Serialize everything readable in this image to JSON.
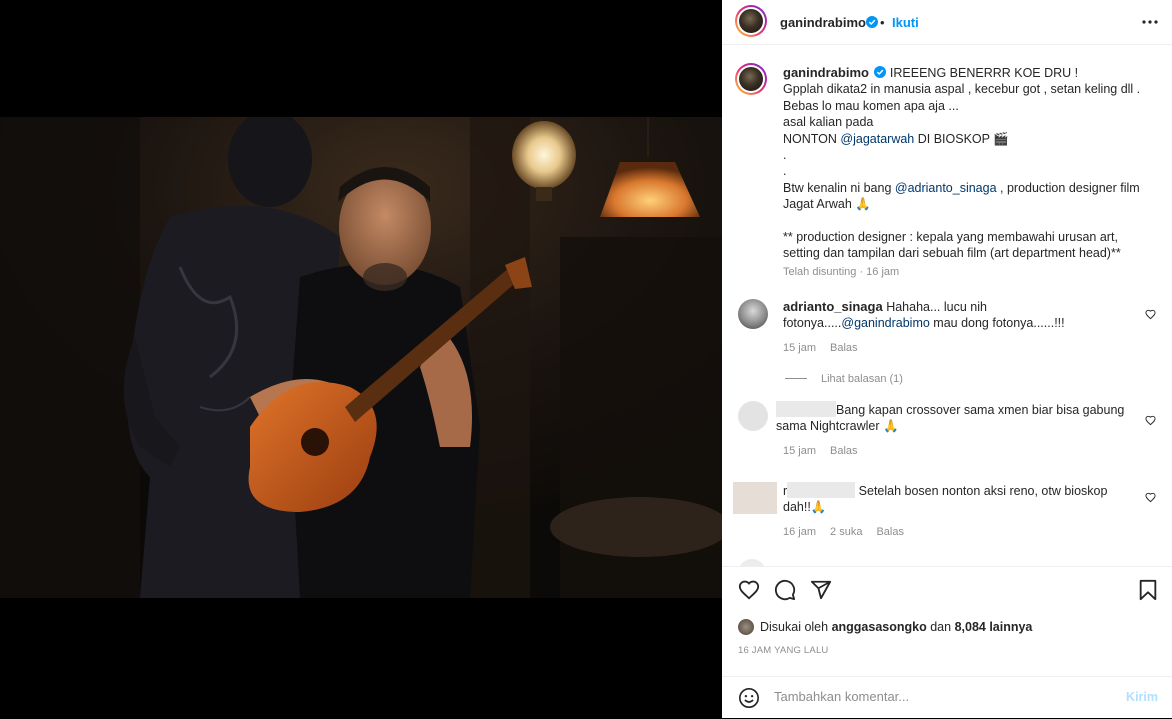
{
  "post": {
    "author": "ganindrabimo",
    "follow_label": "Ikuti",
    "more_icon": "more-horizontal-icon",
    "caption": {
      "title": "IREEENG BENERRR KOE DRU !",
      "line2": "Gpplah dikata2 in manusia aspal , kecebur got , setan keling dll .",
      "line3": "Bebas lo mau komen apa aja ...",
      "line4": "asal kalian pada",
      "line5_prefix": "NONTON ",
      "line5_mention": "@jagatarwah",
      "line5_suffix": " DI BIOSKOP 🎬",
      "dot1": ".",
      "dot2": ".",
      "line8_prefix": "Btw kenalin ni bang ",
      "line8_mention": "@adrianto_sinaga",
      "line8_suffix": " , production designer film Jagat Arwah 🙏",
      "line9": "** production designer : kepala yang membawahi urusan art, setting dan tampilan dari sebuah film (art department head)**",
      "meta": "Telah disunting · 16 jam"
    }
  },
  "comments": [
    {
      "user": "adrianto_sinaga",
      "text_prefix": "Hahaha... lucu nih fotonya.....",
      "mention": "@ganindrabimo",
      "text_suffix": " mau dong fotonya......!!!",
      "time": "15 jam",
      "reply": "Balas"
    },
    {
      "view_replies": "Lihat balasan (1)"
    },
    {
      "text": "Bang kapan crossover sama xmen biar bisa gabung sama Nightcrawler 🙏",
      "time": "15 jam",
      "reply": "Balas"
    },
    {
      "user_initial": "r",
      "text": "Setelah bosen nonton aksi reno, otw bioskop dah!!🙏",
      "time": "16 jam",
      "likes": "2 suka",
      "reply": "Balas"
    }
  ],
  "actions": {
    "like_icon": "heart-icon",
    "comment_icon": "comment-icon",
    "share_icon": "send-icon",
    "save_icon": "bookmark-icon",
    "liked_by_prefix": "Disukai oleh ",
    "liked_by_user": "anggasasongko",
    "liked_by_middle": " dan ",
    "liked_by_count": "8,084 lainnya",
    "timestamp": "16 JAM YANG LALU"
  },
  "add_comment": {
    "emoji_icon": "smiley-icon",
    "placeholder": "Tambahkan komentar...",
    "send_label": "Kirim"
  },
  "colors": {
    "link": "#0095f6",
    "mention": "#00376b",
    "muted": "#8e8e8e",
    "send_disabled": "#b2dffc"
  }
}
